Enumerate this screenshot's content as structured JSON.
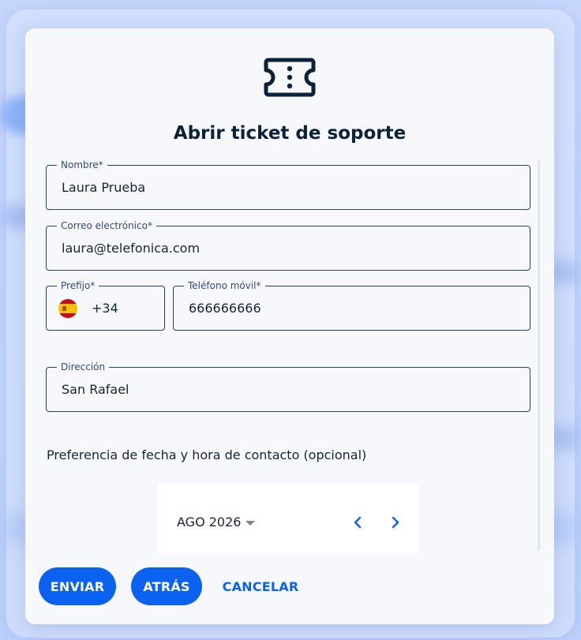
{
  "dialog": {
    "icon": "ticket-icon",
    "title": "Abrir ticket de soporte"
  },
  "form": {
    "nombre": {
      "label": "Nombre*",
      "value": "Laura Prueba"
    },
    "correo": {
      "label": "Correo electrónico*",
      "value": "laura@telefonica.com"
    },
    "prefijo": {
      "label": "Prefijo*",
      "value": "+34",
      "flag": "spain-flag-icon"
    },
    "telefono": {
      "label": "Teléfono móvil*",
      "value": "666666666"
    },
    "direccion": {
      "label": "Dirección",
      "value": "San Rafael"
    },
    "contact_pref_label": "Preferencia de fecha y hora de contacto (opcional)"
  },
  "calendar": {
    "month": "AGO 2026",
    "prev_icon": "chevron-left-icon",
    "next_icon": "chevron-right-icon"
  },
  "actions": {
    "submit_label": "ENVIAR",
    "back_label": "ATRÁS",
    "cancel_label": "CANCELAR"
  },
  "colors": {
    "accent": "#0b62f0",
    "title": "#0b2239",
    "border": "#2b3f6b",
    "backdrop": "#c9d8fb"
  }
}
